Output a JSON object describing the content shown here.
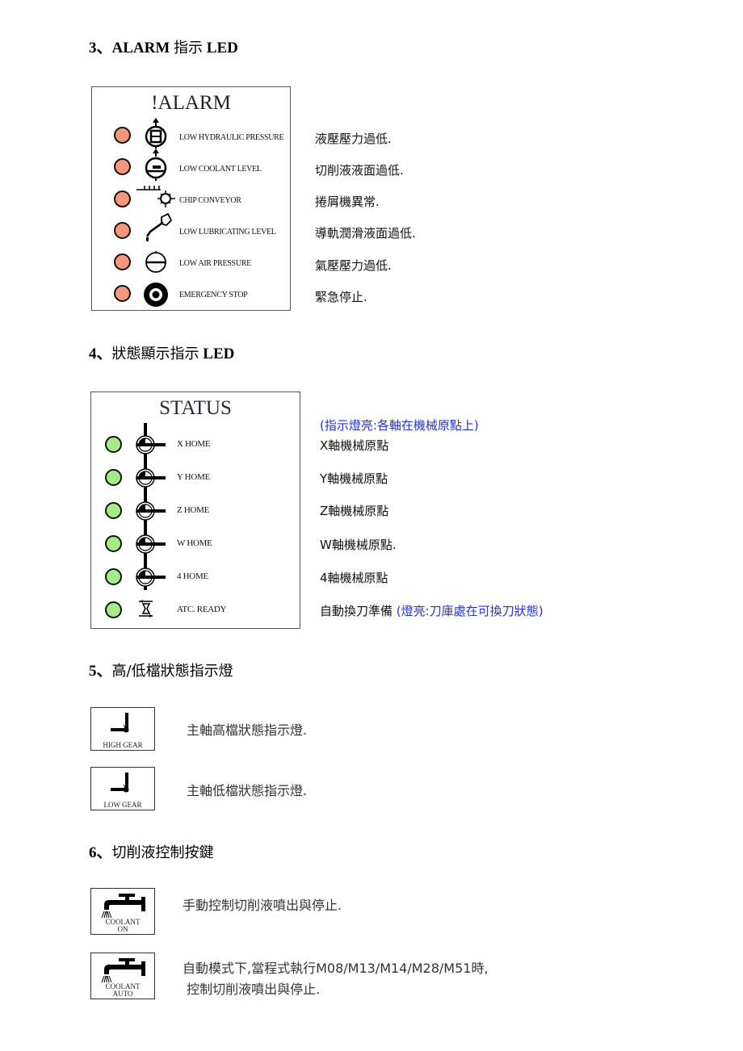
{
  "sections": {
    "alarm": {
      "heading_num": "3、",
      "heading_latin": "ALARM ",
      "heading_cjk": "指示",
      "heading_tail": " LED",
      "panel_title": "!ALARM",
      "led_color": "#f4977a",
      "items": [
        {
          "icon": "hydraulic-pressure-icon",
          "label": "LOW HYDRAULIC PRESSURE",
          "desc": "液壓壓力過低."
        },
        {
          "icon": "coolant-level-icon",
          "label": "LOW COOLANT LEVEL",
          "desc": "切削液液面過低."
        },
        {
          "icon": "chip-conveyor-icon",
          "label": "CHIP CONVEYOR",
          "desc": "捲屑機異常."
        },
        {
          "icon": "lubrication-icon",
          "label": "LOW LUBRICATING LEVEL",
          "desc": "導軌潤滑液面過低."
        },
        {
          "icon": "air-pressure-icon",
          "label": "LOW AIR PRESSURE",
          "desc": "氣壓壓力過低."
        },
        {
          "icon": "emergency-stop-icon",
          "label": "EMERGENCY STOP",
          "desc": "緊急停止."
        }
      ]
    },
    "status": {
      "heading_num": "4、",
      "heading_cjk": "狀態顯示指示",
      "heading_tail": " LED",
      "panel_title": "STATUS",
      "led_color": "#a6ec86",
      "note": "(指示燈亮:各軸在機械原點上)",
      "items": [
        {
          "icon": "home-position-icon",
          "label": "X HOME",
          "desc": "X軸機械原點",
          "note": ""
        },
        {
          "icon": "home-position-icon",
          "label": "Y HOME",
          "desc": "Y軸機械原點",
          "note": ""
        },
        {
          "icon": "home-position-icon",
          "label": "Z HOME",
          "desc": "Z軸機械原點",
          "note": ""
        },
        {
          "icon": "home-position-icon",
          "label": "W HOME",
          "desc": "W軸機械原點.",
          "note": ""
        },
        {
          "icon": "home-position-icon",
          "label": "4 HOME",
          "desc": "4軸機械原點",
          "note": ""
        },
        {
          "icon": "atc-ready-icon",
          "label": "ATC. READY",
          "desc": "自動換刀準備 ",
          "note": "(燈亮:刀庫處在可換刀狀態)"
        }
      ]
    },
    "gear": {
      "heading_num": "5、",
      "heading_cjk": "高/低檔狀態指示燈",
      "items": [
        {
          "icon": "spindle-gear-icon",
          "label": "HIGH GEAR",
          "desc": "主軸高檔狀態指示燈."
        },
        {
          "icon": "spindle-gear-icon",
          "label": "LOW GEAR",
          "desc": "主軸低檔狀態指示燈."
        }
      ]
    },
    "coolant": {
      "heading_num": "6、",
      "heading_cjk": "切削液控制按鍵",
      "items": [
        {
          "icon": "coolant-faucet-icon",
          "label_line1": "COOLANT",
          "label_line2": "ON",
          "desc_line1": "手動控制切削液噴出與停止.",
          "desc_line2": ""
        },
        {
          "icon": "coolant-faucet-icon",
          "label_line1": "COOLANT",
          "label_line2": "AUTO",
          "desc_line1": "自動模式下,當程式執行M08/M13/M14/M28/M51時,",
          "desc_line2": " 控制切削液噴出與停止."
        }
      ]
    }
  }
}
